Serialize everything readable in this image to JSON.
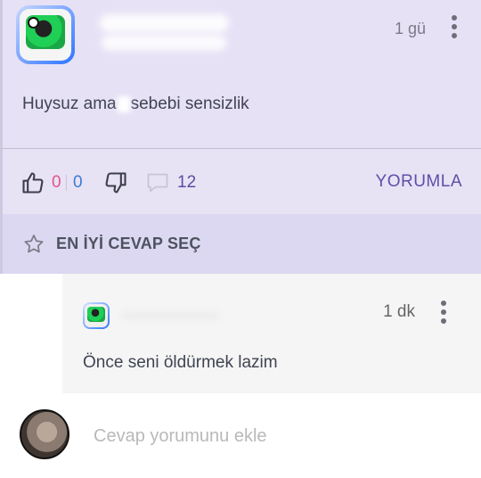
{
  "post": {
    "time": "1 gü",
    "text_before": "Huysuz ama",
    "text_after": "sebebi sensizlik"
  },
  "actions": {
    "likes_a": "0",
    "likes_b": "0",
    "comments": "12",
    "reply_label": "YORUMLA"
  },
  "best_answer": {
    "label": "EN İYİ CEVAP SEÇ"
  },
  "reply": {
    "time": "1 dk",
    "text": "Önce seni öldürmek lazim"
  },
  "composer": {
    "placeholder": "Cevap yorumunu ekle"
  },
  "colors": {
    "post_bg": "#e7e1f5",
    "best_bg": "#dcd8f1",
    "accent": "#5e4fa8",
    "like_pink": "#e3558a",
    "like_blue": "#3d7bd6"
  }
}
